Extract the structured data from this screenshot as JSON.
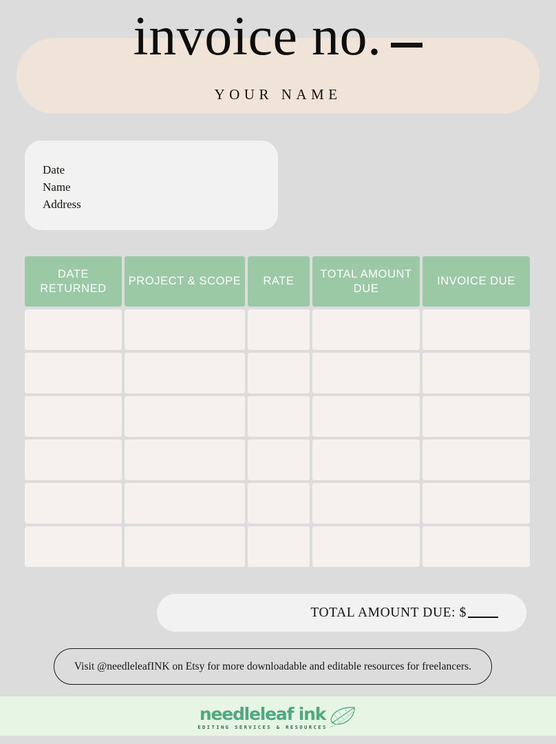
{
  "page": {
    "background_color": "#dcdcdc"
  },
  "header": {
    "banner_color": "#efe4d7",
    "title": "invoice no.",
    "title_blank": "_",
    "subtitle": "YOUR NAME"
  },
  "info_box": {
    "background_color": "#f2f2f2",
    "lines": [
      "Date",
      "Name",
      "Address"
    ]
  },
  "table": {
    "header_color": "#9bc8a5",
    "cell_color": "#f6f1ee",
    "columns": [
      "DATE RETURNED",
      "PROJECT & SCOPE",
      "RATE",
      "TOTAL AMOUNT DUE",
      "INVOICE DUE"
    ],
    "rows": [
      [
        "",
        "",
        "",
        "",
        ""
      ],
      [
        "",
        "",
        "",
        "",
        ""
      ],
      [
        "",
        "",
        "",
        "",
        ""
      ],
      [
        "",
        "",
        "",
        "",
        ""
      ],
      [
        "",
        "",
        "",
        "",
        ""
      ],
      [
        "",
        "",
        "",
        "",
        ""
      ]
    ]
  },
  "total": {
    "label": "TOTAL AMOUNT DUE: $",
    "value": ""
  },
  "footer": {
    "note": "Visit @needleleafINK on Etsy for more downloadable and editable resources for freelancers."
  },
  "brand": {
    "strip_color": "#e6f5e4",
    "name": "needleleaf ink",
    "tagline": "EDITING SERVICES & RESOURCES",
    "color": "#4fa882",
    "icon": "leaf-icon"
  }
}
